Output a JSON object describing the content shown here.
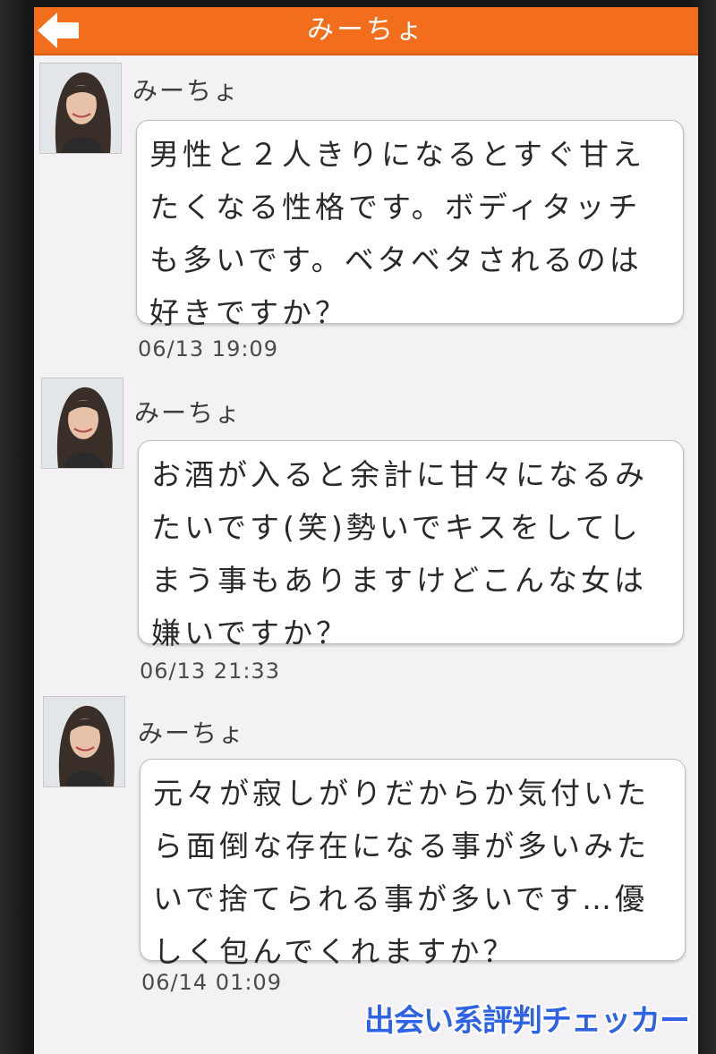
{
  "header": {
    "title": "みーちょ",
    "back_icon": "back-arrow-icon",
    "background_color": "#f36e1c"
  },
  "messages": [
    {
      "sender": "みーちょ",
      "text": "男性と２人きりになるとすぐ甘えたくなる性格です。ボディタッチも多いです。ベタベタされるのは好きですか？",
      "time": "06/13 19:09"
    },
    {
      "sender": "みーちょ",
      "text": "お酒が入ると余計に甘々になるみたいです(笑)勢いでキスをしてしまう事もありますけどこんな女は嫌いですか？",
      "time": "06/13 21:33"
    },
    {
      "sender": "みーちょ",
      "text": "元々が寂しがりだからか気付いたら面倒な存在になる事が多いみたいで捨てられる事が多いです…優しく包んでくれますか？",
      "time": "06/14 01:09"
    }
  ],
  "watermark": "出会い系評判チェッカー"
}
